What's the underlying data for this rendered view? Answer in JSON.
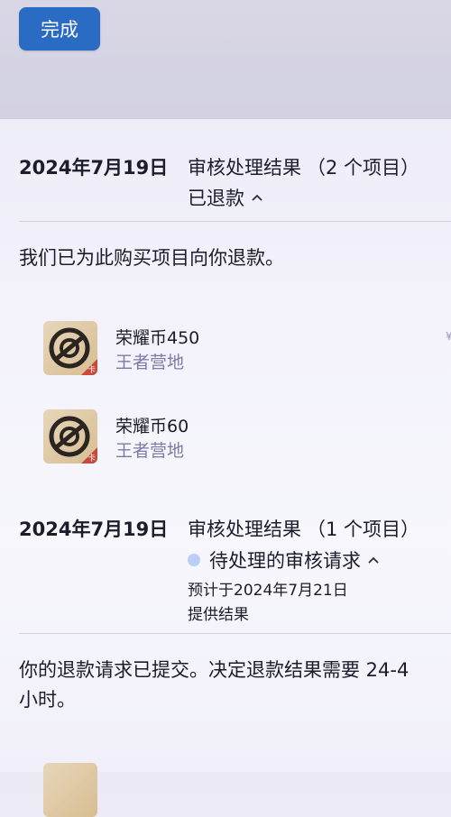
{
  "toolbar": {
    "done_label": "完成"
  },
  "sections": [
    {
      "date": "2024年7月19日",
      "title": "审核处理结果",
      "count": "（2 个项目）",
      "status": "已退款",
      "message": "我们已为此购买项目向你退款。",
      "items": [
        {
          "name": "荣耀币450",
          "publisher": "王者营地"
        },
        {
          "name": "荣耀币60",
          "publisher": "王者营地"
        }
      ]
    },
    {
      "date": "2024年7月19日",
      "title": "审核处理结果",
      "count": "（1 个项目）",
      "status": "待处理的审核请求",
      "eta_line1": "预计于2024年7月21日",
      "eta_line2": "提供结果",
      "message_line1": "你的退款请求已提交。决定退款结果需要 24-4",
      "message_line2": "小时。"
    }
  ],
  "colors": {
    "accent": "#2a6bc4",
    "pending_dot": "#b9d0f4",
    "subtitle": "#7a7ca6"
  },
  "icons": {
    "app_icon": "wangzhe-yingdi-app-icon",
    "status_chevron": "chevron-up-icon"
  }
}
